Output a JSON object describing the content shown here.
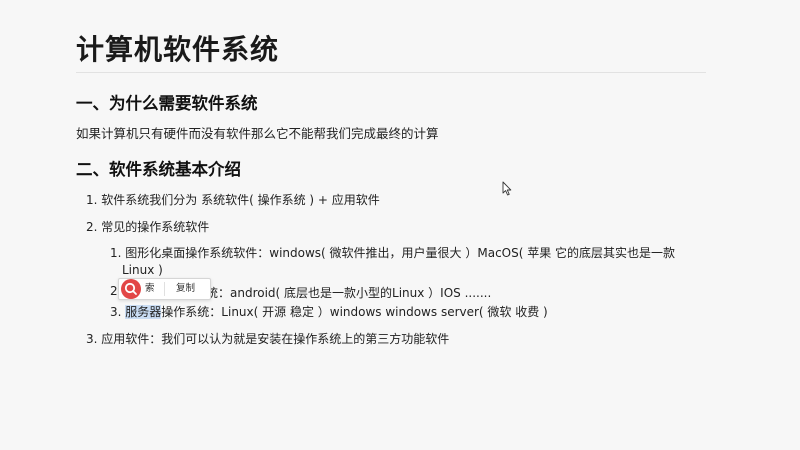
{
  "doc": {
    "title": "计算机软件系统",
    "section1": {
      "heading": "一、为什么需要软件系统",
      "paragraph": "如果计算机只有硬件而没有软件那么它不能帮我们完成最终的计算"
    },
    "section2": {
      "heading": "二、软件系统基本介绍",
      "item1": "1. 软件系统我们分为 系统软件( 操作系统 ) + 应用软件",
      "item2": "2. 常见的操作系统软件",
      "sub1_line1": "1. 图形化桌面操作系统软件：windows( 微软件推出，用户量很大 ）MacOS( 苹果 它的底层其实也是一款",
      "sub1_line2": "Linux )",
      "sub2_num": "2.",
      "sub2_rest": "统：android( 底层也是一款小型的Linux ）IOS .......",
      "sub3_num": "3.",
      "sub3_selected": "服务器",
      "sub3_rest": "操作系统：Linux( 开源 稳定 ）windows windows server( 微软 收费 )",
      "item3": "3. 应用软件：我们可以认为就是安装在操作系统上的第三方功能软件"
    }
  },
  "context_menu": {
    "search_label": "索",
    "copy_label": "复制",
    "search_icon_color": "#e24646"
  }
}
